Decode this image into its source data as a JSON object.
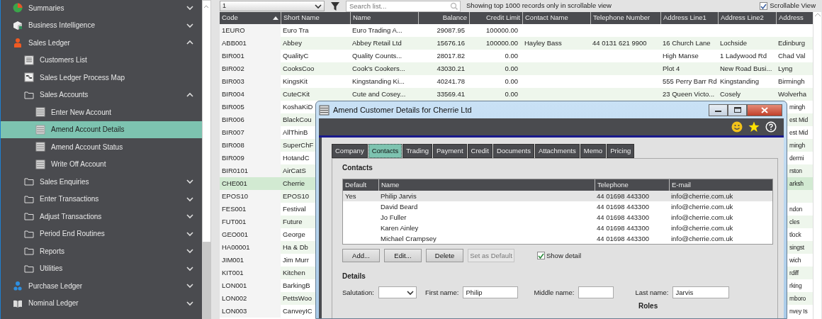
{
  "sidebar": {
    "items": [
      {
        "label": "Summaries",
        "kind": "chart",
        "expanded": false,
        "selected": false
      },
      {
        "label": "Business Intelligence",
        "kind": "cube",
        "expanded": false,
        "selected": false
      },
      {
        "label": "Sales Ledger",
        "kind": "seller",
        "expanded": true,
        "selected": false,
        "children": [
          {
            "label": "Customers List",
            "kind": "list",
            "selected": false
          },
          {
            "label": "Sales Ledger Process Map",
            "kind": "map",
            "selected": false
          },
          {
            "label": "Sales Accounts",
            "kind": "folder",
            "expanded": true,
            "selected": false,
            "children": [
              {
                "label": "Enter New Account",
                "kind": "form",
                "selected": false
              },
              {
                "label": "Amend Account Details",
                "kind": "form",
                "selected": true
              },
              {
                "label": "Amend Account Status",
                "kind": "form",
                "selected": false
              },
              {
                "label": "Write Off Account",
                "kind": "form",
                "selected": false
              }
            ]
          },
          {
            "label": "Sales Enquiries",
            "kind": "folder",
            "expanded": false,
            "selected": false
          },
          {
            "label": "Enter Transactions",
            "kind": "folder",
            "expanded": false,
            "selected": false
          },
          {
            "label": "Adjust Transactions",
            "kind": "folder",
            "expanded": false,
            "selected": false
          },
          {
            "label": "Period End Routines",
            "kind": "folder",
            "expanded": false,
            "selected": false
          },
          {
            "label": "Reports",
            "kind": "folder",
            "expanded": false,
            "selected": false
          },
          {
            "label": "Utilities",
            "kind": "folder",
            "expanded": false,
            "selected": false
          }
        ]
      },
      {
        "label": "Purchase Ledger",
        "kind": "buyer",
        "expanded": false,
        "selected": false
      },
      {
        "label": "Nominal Ledger",
        "kind": "book",
        "expanded": false,
        "selected": false
      }
    ]
  },
  "toolbar": {
    "page_selector": {
      "value": "1"
    },
    "search": {
      "placeholder": "Search list..."
    },
    "record_note": "Showing top 1000 records only in scrollable view",
    "scrollable_view": {
      "label": "Scrollable View",
      "checked": true
    }
  },
  "table": {
    "columns": [
      {
        "label": "Code",
        "sorted": true
      },
      {
        "label": "Short Name",
        "sorted": false
      },
      {
        "label": "Name",
        "sorted": false
      },
      {
        "label": "Balance",
        "sorted": false
      },
      {
        "label": "Credit Limit",
        "sorted": false
      },
      {
        "label": "Contact Name",
        "sorted": false
      },
      {
        "label": "Telephone Number",
        "sorted": false
      },
      {
        "label": "Address Line1",
        "sorted": false
      },
      {
        "label": "Address Line2",
        "sorted": false
      },
      {
        "label": "Address",
        "sorted": false
      }
    ],
    "rows": [
      {
        "code": "1EURO",
        "short_name": "Euro Tra",
        "name": "Euro Trading A...",
        "balance": "29087.95",
        "credit_limit": "100000.00",
        "selected": false
      },
      {
        "code": "ABB001",
        "short_name": "Abbey",
        "name": "Abbey Retail Ltd",
        "balance": "15676.16",
        "credit_limit": "100000.00",
        "contact_name": "Hayley Bass",
        "telephone_number": "44 0131 621 9900",
        "address_line1": "16 Church Lane",
        "address_line2": "Lochside",
        "address_line3": "Edinburg",
        "selected": false
      },
      {
        "code": "BIR001",
        "short_name": "QualityC",
        "name": "Quality Counts...",
        "balance": "28017.82",
        "credit_limit": "0.00",
        "address_line1": "High Manse",
        "address_line2": "1 Ladywood Rd",
        "address_line3": "Chad Val",
        "selected": false
      },
      {
        "code": "BIR002",
        "short_name": "CooksCoo",
        "name": "Cook's Cookers...",
        "balance": "43030.21",
        "credit_limit": "0.00",
        "address_line1": "Plot 4",
        "address_line2": "New Road Busi...",
        "address_line3": "Lyng",
        "selected": false
      },
      {
        "code": "BIR003",
        "short_name": "KingsKit",
        "name": "Kingstanding Ki...",
        "balance": "40241.78",
        "credit_limit": "0.00",
        "address_line1": "555 Perry Barr Rd",
        "address_line2": "Kingstanding",
        "address_line3": "Birmingh",
        "selected": false
      },
      {
        "code": "BIR004",
        "short_name": "CuteCKit",
        "name": "Cute and Cosey...",
        "balance": "33569.41",
        "credit_limit": "0.00",
        "address_line1": "23 Queen Victo...",
        "address_line2": "Cosely",
        "address_line3": "Wolverha",
        "selected": false
      },
      {
        "code": "BIR005",
        "short_name": "KoshaKiD",
        "address_line3": "mingh",
        "selected": false
      },
      {
        "code": "BIR006",
        "short_name": "BlackCou",
        "address_line3": "est Mid",
        "selected": false
      },
      {
        "code": "BIR007",
        "short_name": "AllThinB",
        "address_line3": "est Mid",
        "selected": false
      },
      {
        "code": "BIR008",
        "short_name": "SuperChF",
        "address_line3": "mingh",
        "selected": false
      },
      {
        "code": "BIR009",
        "short_name": "HotandC",
        "address_line3": "dermi",
        "selected": false
      },
      {
        "code": "BIR0101",
        "short_name": "AirCatS",
        "address_line3": "rston",
        "selected": false
      },
      {
        "code": "CHE001",
        "short_name": "Cherrie",
        "address_line3": "arksh",
        "selected": true
      },
      {
        "code": "EPOS10",
        "short_name": "EPOS10",
        "selected": false
      },
      {
        "code": "FES001",
        "short_name": "Festival",
        "address_line3": "ndon",
        "selected": false
      },
      {
        "code": "FUT001",
        "short_name": "Future",
        "address_line3": "cles",
        "selected": false
      },
      {
        "code": "GEO001",
        "short_name": "George",
        "address_line3": "tlock",
        "selected": false
      },
      {
        "code": "HA00001",
        "short_name": "Ha & Db",
        "address_line3": "singst",
        "selected": false
      },
      {
        "code": "JIM001",
        "short_name": "Jim Murr",
        "address_line3": "wich",
        "selected": false
      },
      {
        "code": "KIT001",
        "short_name": "Kitchen",
        "address_line3": "rdiff",
        "selected": false
      },
      {
        "code": "LON001",
        "short_name": "BarkingB",
        "address_line3": "rking",
        "selected": false
      },
      {
        "code": "LON002",
        "short_name": "PettsWoo",
        "address_line3": "mboro",
        "selected": false
      },
      {
        "code": "LON003",
        "short_name": "CanveyIC",
        "address_line3": "nvey Is",
        "selected": false
      }
    ]
  },
  "dialog": {
    "title": "Amend Customer Details for Cherrie Ltd",
    "tabs": [
      {
        "label": "Company",
        "selected": false
      },
      {
        "label": "Contacts",
        "selected": true
      },
      {
        "label": "Trading",
        "selected": false
      },
      {
        "label": "Payment",
        "selected": false
      },
      {
        "label": "Credit",
        "selected": false
      },
      {
        "label": "Documents",
        "selected": false
      },
      {
        "label": "Attachments",
        "selected": false
      },
      {
        "label": "Memo",
        "selected": false
      },
      {
        "label": "Pricing",
        "selected": false
      }
    ],
    "contacts": {
      "heading": "Contacts",
      "columns": [
        "Default",
        "Name",
        "Telephone",
        "E-mail"
      ],
      "rows": [
        {
          "default": "Yes",
          "name": "Philip Jarvis",
          "telephone": "44 01698 443300",
          "email": "info@cherrie.com.uk",
          "selected": true
        },
        {
          "name": "David Beard",
          "telephone": "44 01698 443300",
          "email": "info@cherrie.com.uk",
          "selected": false
        },
        {
          "name": "Jo Fuller",
          "telephone": "44 01698 443300",
          "email": "info@cherrie.com.uk",
          "selected": false
        },
        {
          "name": "Karen Ainley",
          "telephone": "44 01698 443300",
          "email": "info@cherrie.com.uk",
          "selected": false
        },
        {
          "name": "Michael Crampsey",
          "telephone": "44 01698 443300",
          "email": "info@cherrie.com.uk",
          "selected": false
        }
      ]
    },
    "buttons": [
      {
        "label": "Add...",
        "disabled": false
      },
      {
        "label": "Edit...",
        "disabled": false
      },
      {
        "label": "Delete",
        "disabled": false
      },
      {
        "label": "Set as Default",
        "disabled": true
      }
    ],
    "show_detail": {
      "label": "Show detail",
      "checked": true
    },
    "details": {
      "heading": "Details",
      "fields": [
        {
          "label": "Salutation:",
          "kind": "select"
        },
        {
          "label": "First name:",
          "kind": "text",
          "value": "Philip"
        },
        {
          "label": "Middle name:",
          "kind": "text"
        },
        {
          "label": "Last name:",
          "kind": "text",
          "value": "Jarvis"
        }
      ]
    },
    "roles_heading": "Roles"
  }
}
